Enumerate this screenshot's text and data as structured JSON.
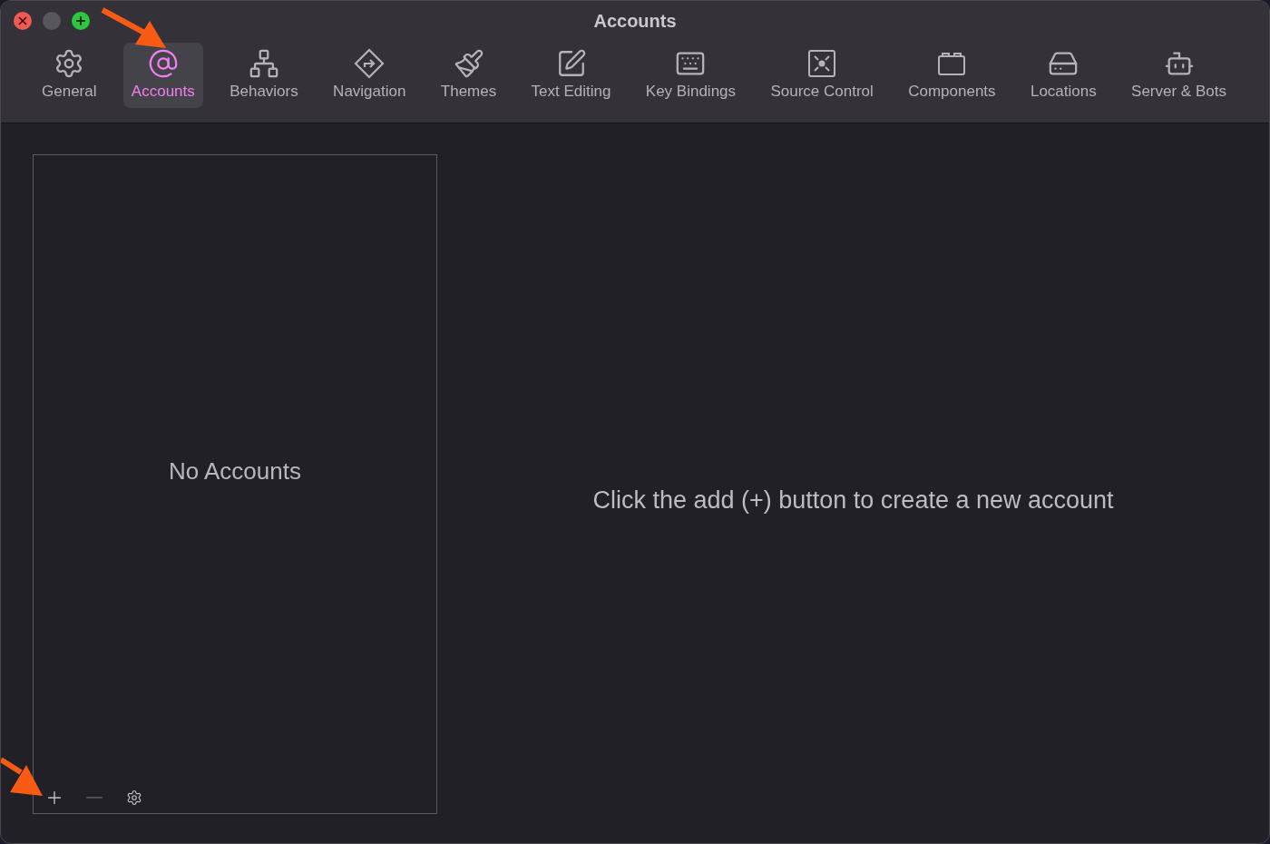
{
  "window": {
    "title": "Accounts"
  },
  "tabs": [
    {
      "label": "General",
      "kind": "gear",
      "selected": false
    },
    {
      "label": "Accounts",
      "kind": "at",
      "selected": true
    },
    {
      "label": "Behaviors",
      "kind": "network",
      "selected": false
    },
    {
      "label": "Navigation",
      "kind": "diamond",
      "selected": false
    },
    {
      "label": "Themes",
      "kind": "brush",
      "selected": false
    },
    {
      "label": "Text Editing",
      "kind": "pen",
      "selected": false
    },
    {
      "label": "Key Bindings",
      "kind": "keyboard",
      "selected": false
    },
    {
      "label": "Source Control",
      "kind": "safe",
      "selected": false
    },
    {
      "label": "Components",
      "kind": "box",
      "selected": false
    },
    {
      "label": "Locations",
      "kind": "drive",
      "selected": false
    },
    {
      "label": "Server & Bots",
      "kind": "bot",
      "selected": false
    }
  ],
  "accounts_list": {
    "empty_text": "No Accounts",
    "buttons": [
      {
        "kind": "add",
        "disabled": false
      },
      {
        "kind": "remove",
        "disabled": true
      },
      {
        "kind": "settings",
        "disabled": false
      }
    ]
  },
  "detail": {
    "message": "Click the add (+) button to create a new account"
  }
}
